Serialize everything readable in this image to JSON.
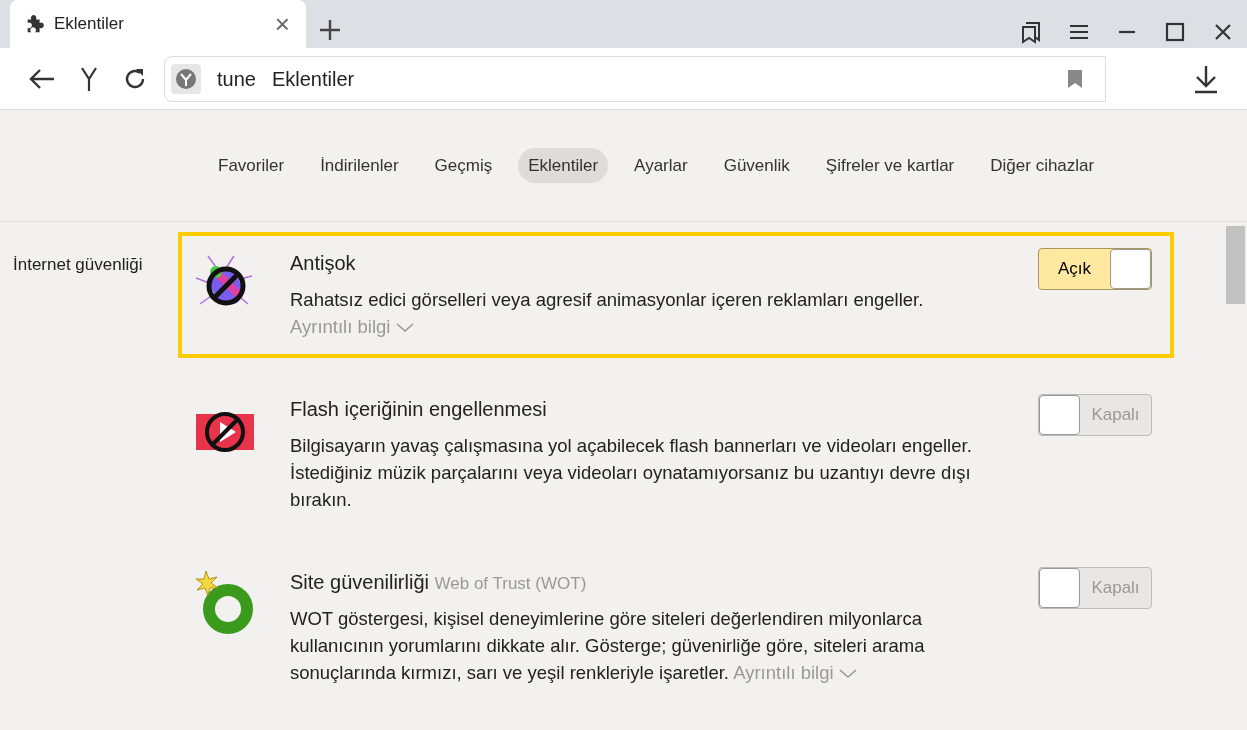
{
  "browser_tab": {
    "title": "Eklentiler",
    "close": "×"
  },
  "address_bar": {
    "host": "tune",
    "page": "Eklentiler"
  },
  "nav": [
    {
      "label": "Favoriler",
      "selected": false
    },
    {
      "label": "İndirilenler",
      "selected": false
    },
    {
      "label": "Geçmiş",
      "selected": false
    },
    {
      "label": "Eklentiler",
      "selected": true
    },
    {
      "label": "Ayarlar",
      "selected": false
    },
    {
      "label": "Güvenlik",
      "selected": false
    },
    {
      "label": "Şifreler ve kartlar",
      "selected": false
    },
    {
      "label": "Diğer cihazlar",
      "selected": false
    }
  ],
  "section": {
    "title": "İnternet güvenliği"
  },
  "extensions": [
    {
      "kind": "bug",
      "name": "Antişok",
      "description": "Rahatsız edici görselleri veya agresif animasyonlar içeren reklamları engeller.",
      "more_link": "Ayrıntılı bilgi",
      "more_inline": false,
      "highlighted": true,
      "on": true,
      "toggle_label": "Açık"
    },
    {
      "kind": "flash",
      "name": "Flash içeriğinin engellenmesi",
      "description": "Bilgisayarın yavaş çalışmasına yol açabilecek flash bannerları ve videoları engeller. İstediğiniz müzik parçalarını veya videoları oynatamıyorsanız bu uzantıyı devre dışı bırakın.",
      "highlighted": false,
      "on": false,
      "toggle_label": "Kapalı"
    },
    {
      "kind": "ring",
      "name": "Site güvenilirliği",
      "subtitle": "Web of Trust (WOT)",
      "description": "WOT göstergesi, kişisel deneyimlerine göre siteleri değerlendiren milyonlarca kullanıcının yorumlarını dikkate alır. Gösterge; güvenirliğe göre, siteleri arama sonuçlarında kırmızı, sarı ve yeşil renkleriyle işaretler.",
      "more_link": "Ayrıntılı bilgi",
      "more_inline": true,
      "highlighted": false,
      "on": false,
      "toggle_label": "Kapalı"
    }
  ]
}
